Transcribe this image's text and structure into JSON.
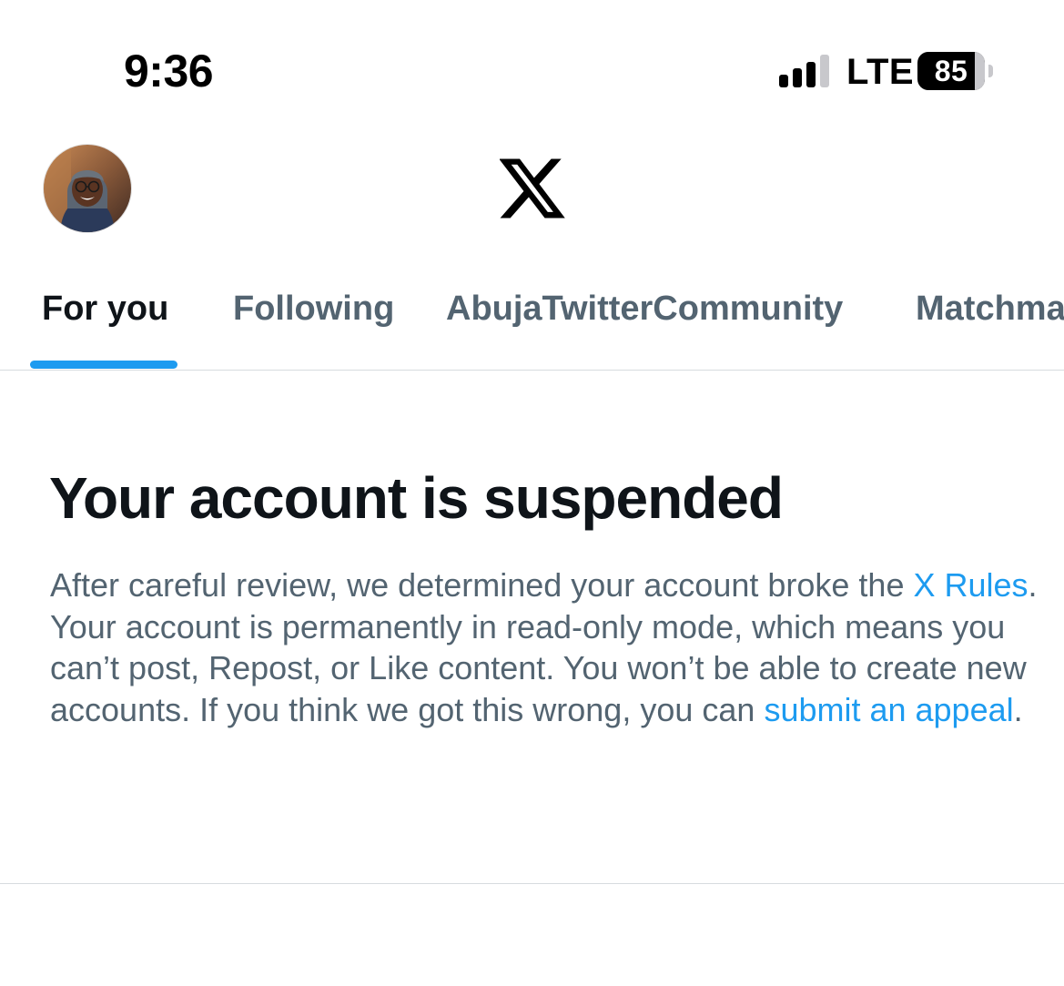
{
  "status_bar": {
    "time": "9:36",
    "network": "LTE",
    "battery_level": "85",
    "battery_fraction": 0.85,
    "signal_bars_active": 3,
    "signal_bars_total": 4
  },
  "header": {
    "avatar_icon": "profile-avatar",
    "logo_icon": "x-logo-icon"
  },
  "tabs": [
    {
      "label": "For you",
      "active": true
    },
    {
      "label": "Following",
      "active": false
    },
    {
      "label": "AbujaTwitterCommunity",
      "active": false
    },
    {
      "label": "Matchma",
      "active": false
    }
  ],
  "notice": {
    "title": "Your account is suspended",
    "body_part1": "After careful review, we determined your account broke the ",
    "rules_link": "X Rules",
    "body_part2": ". Your account is permanently in read-only mode, which means you can’t post, Repost, or Like content. You won’t be able to create new accounts. If you think we got this wrong, you can ",
    "appeal_link": "submit an appeal",
    "body_part3": "."
  },
  "colors": {
    "accent": "#1d9bf0",
    "text_primary": "#0f1419",
    "text_secondary": "#536471",
    "divider": "#d7dbdf"
  }
}
